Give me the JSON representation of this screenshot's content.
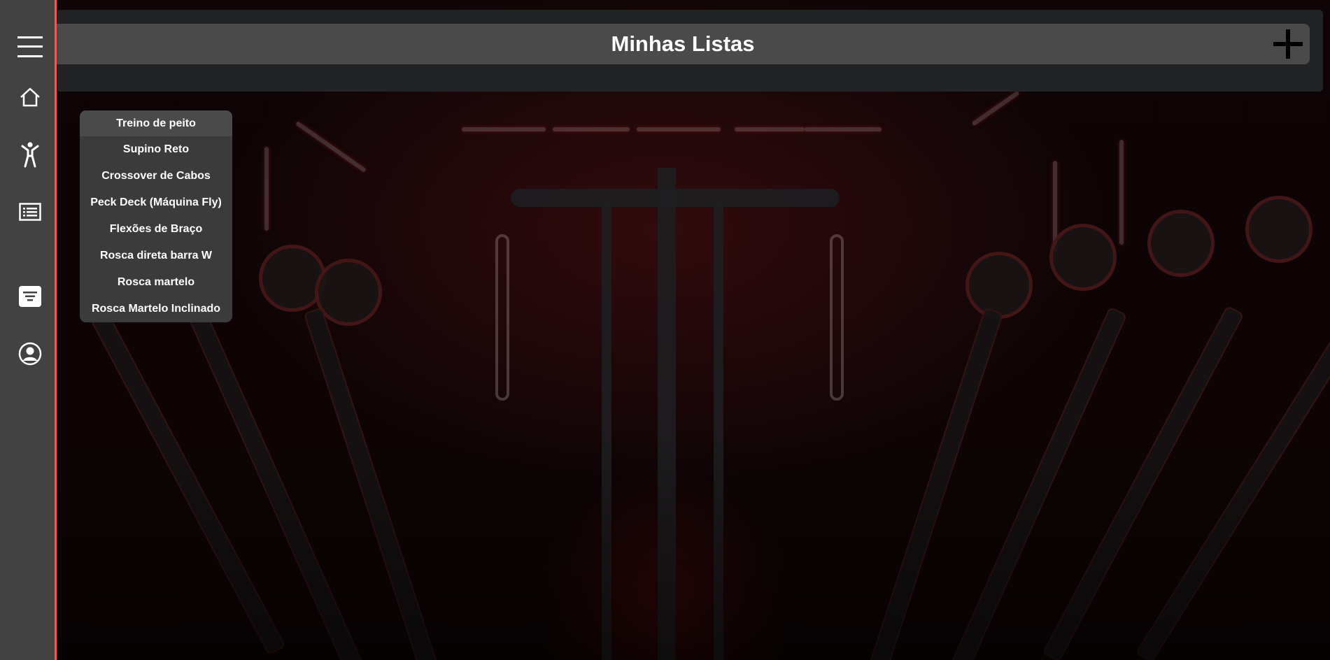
{
  "header": {
    "title": "Minhas Listas",
    "add_icon": "plus-icon"
  },
  "sidebar": {
    "accent_color": "#e0615b",
    "items": [
      {
        "icon": "hamburger-menu-icon"
      },
      {
        "icon": "home-icon"
      },
      {
        "icon": "person-exercise-icon"
      },
      {
        "icon": "list-icon"
      },
      {
        "icon": "filter-icon"
      },
      {
        "icon": "user-profile-icon"
      }
    ]
  },
  "list_menu": {
    "header": "Treino de peito",
    "items": [
      "Supino Reto",
      "Crossover de Cabos",
      "Peck Deck (Máquina Fly)",
      "Flexões de Braço",
      "Rosca direta barra W",
      "Rosca martelo",
      "Rosca Martelo Inclinado"
    ]
  }
}
